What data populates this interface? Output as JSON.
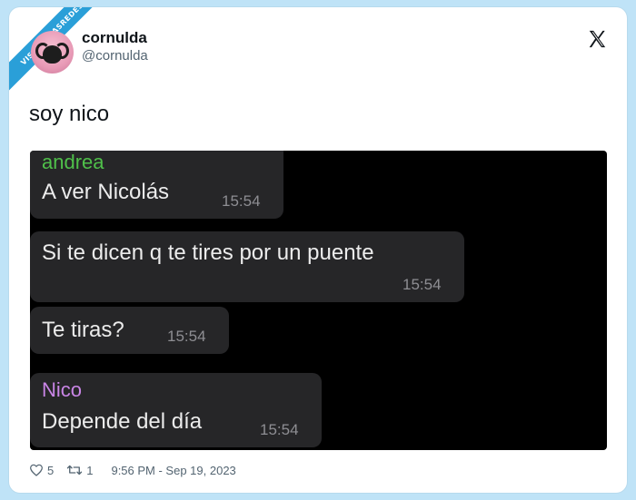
{
  "watermark": {
    "text": "VISTOENLASREDES"
  },
  "author": {
    "name": "cornulda",
    "handle": "@cornulda"
  },
  "platform_icon": "x-logo-icon",
  "tweet": {
    "text": "soy nico"
  },
  "chat": {
    "messages": [
      {
        "sender": "andrea",
        "sender_color": "#4fbf4a",
        "text": "A ver Nicolás",
        "time": "15:54"
      },
      {
        "sender": "",
        "text": "Si te dicen q te tires por un puente",
        "time": "15:54"
      },
      {
        "sender": "",
        "text": "Te tiras?",
        "time": "15:54"
      },
      {
        "sender": "Nico",
        "sender_color": "#c985e6",
        "text": "Depende del día",
        "time": "15:54"
      }
    ]
  },
  "footer": {
    "likes": "5",
    "retweets": "1",
    "timestamp": "9:56 PM - Sep 19, 2023"
  }
}
